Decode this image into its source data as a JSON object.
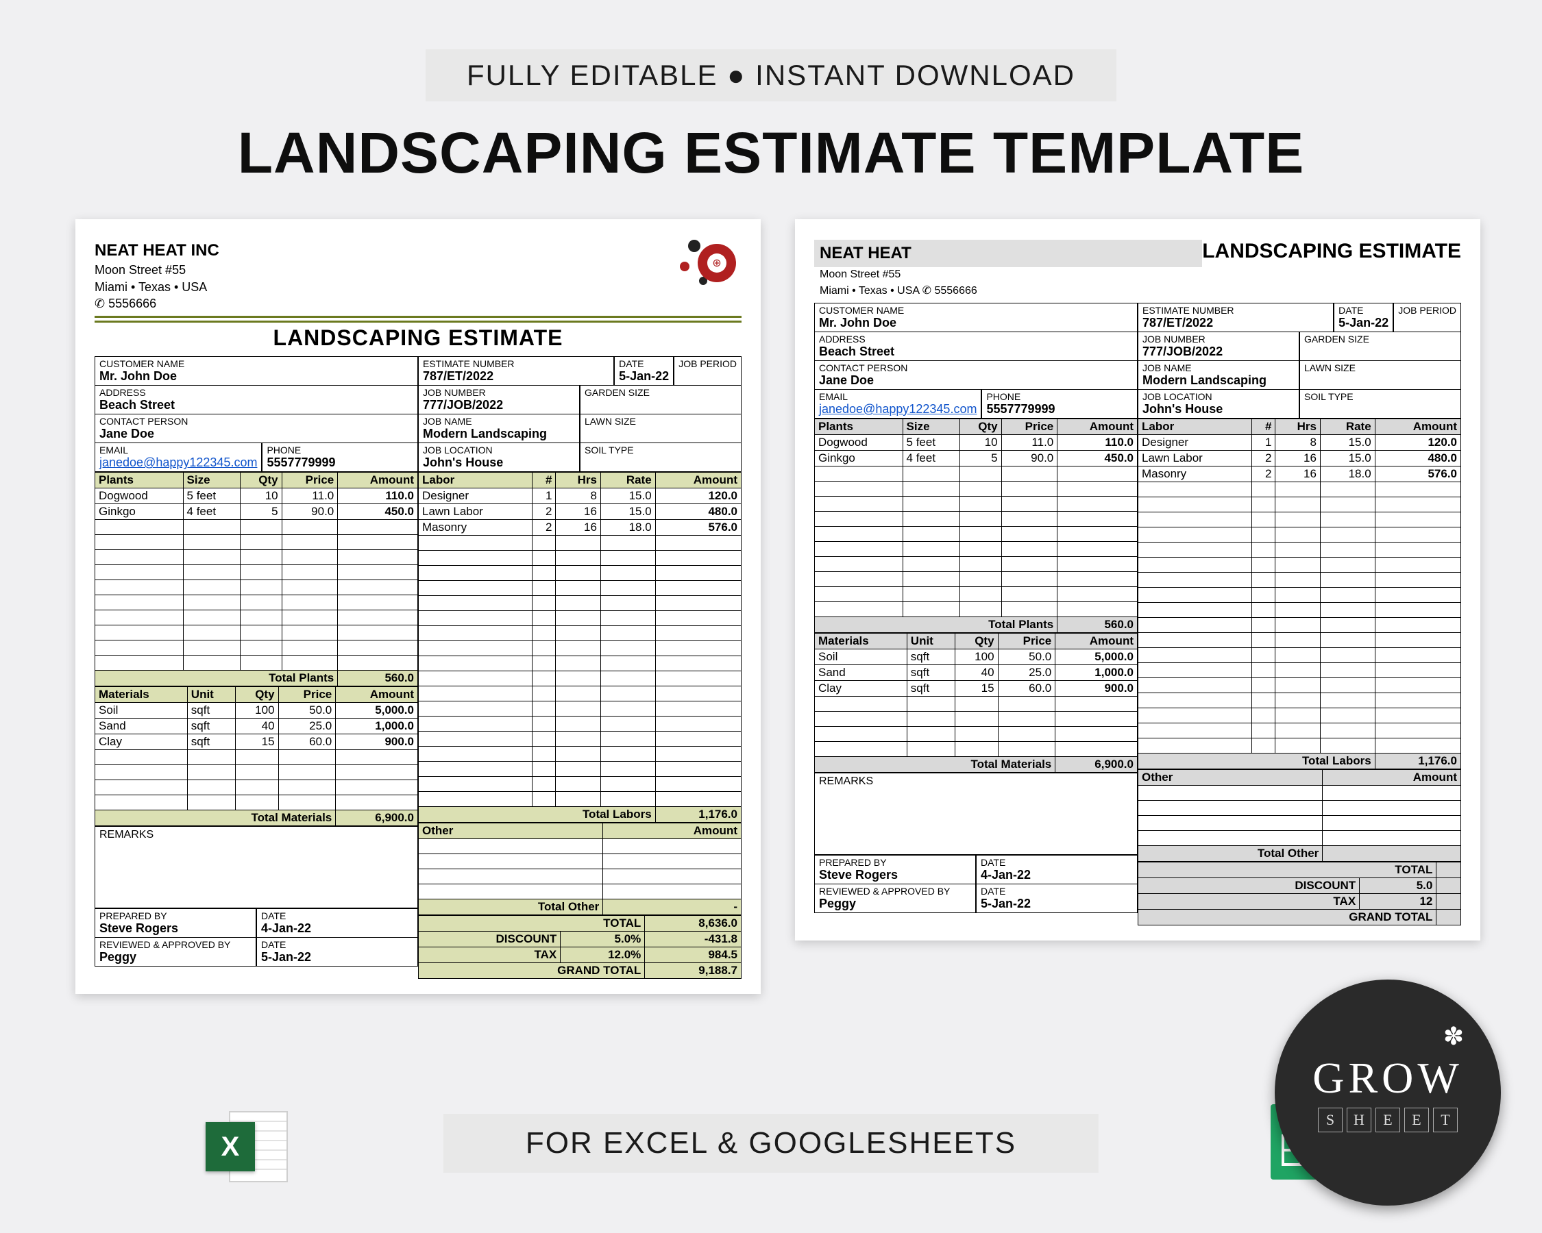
{
  "topBadge": "FULLY EDITABLE ● INSTANT DOWNLOAD",
  "mainTitle": "LANDSCAPING ESTIMATE TEMPLATE",
  "footerBand": "FOR EXCEL & GOOGLESHEETS",
  "growBadge": {
    "word": "GROW",
    "letters": [
      "S",
      "H",
      "E",
      "E",
      "T"
    ]
  },
  "docCommon": {
    "title": "LANDSCAPING ESTIMATE",
    "labels": {
      "customer": "CUSTOMER NAME",
      "address": "ADDRESS",
      "contact": "CONTACT PERSON",
      "email": "EMAIL",
      "phone": "PHONE",
      "estNo": "ESTIMATE NUMBER",
      "date": "DATE",
      "jobPeriod": "JOB PERIOD",
      "jobNo": "JOB NUMBER",
      "garden": "GARDEN SIZE",
      "jobName": "JOB NAME",
      "lawn": "LAWN SIZE",
      "jobLoc": "JOB LOCATION",
      "soil": "SOIL TYPE",
      "remarks": "REMARKS",
      "prepared": "PREPARED BY",
      "reviewed": "REVIEWED & APPROVED BY",
      "dateL": "DATE",
      "total": "TOTAL",
      "discount": "DISCOUNT",
      "tax": "TAX",
      "grand": "GRAND TOTAL",
      "totalPlants": "Total Plants",
      "totalMaterials": "Total Materials",
      "totalLabors": "Total Labors",
      "totalOther": "Total Other"
    },
    "headers": {
      "plants": [
        "Plants",
        "Size",
        "Qty",
        "Price",
        "Amount"
      ],
      "materials": [
        "Materials",
        "Unit",
        "Qty",
        "Price",
        "Amount"
      ],
      "labor": [
        "Labor",
        "#",
        "Hrs",
        "Rate",
        "Amount"
      ],
      "other": [
        "Other",
        "Amount"
      ]
    }
  },
  "left": {
    "brand": {
      "name": "NEAT HEAT INC",
      "street": "Moon Street #55",
      "city": "Miami • Texas • USA",
      "phone": "✆ 5556666"
    },
    "info": {
      "customer": "Mr. John Doe",
      "address": "Beach Street",
      "contact": "Jane Doe",
      "email": "janedoe@happy122345.com",
      "phone": "5557779999",
      "estNo": "787/ET/2022",
      "date": "5-Jan-22",
      "jobNo": "777/JOB/2022",
      "jobName": "Modern Landscaping",
      "jobLoc": "John's House"
    },
    "plants": [
      {
        "name": "Dogwood",
        "size": "5 feet",
        "qty": "10",
        "price": "11.0",
        "amount": "110.0"
      },
      {
        "name": "Ginkgo",
        "size": "4 feet",
        "qty": "5",
        "price": "90.0",
        "amount": "450.0"
      }
    ],
    "plantsTotal": "560.0",
    "materials": [
      {
        "name": "Soil",
        "unit": "sqft",
        "qty": "100",
        "price": "50.0",
        "amount": "5,000.0"
      },
      {
        "name": "Sand",
        "unit": "sqft",
        "qty": "40",
        "price": "25.0",
        "amount": "1,000.0"
      },
      {
        "name": "Clay",
        "unit": "sqft",
        "qty": "15",
        "price": "60.0",
        "amount": "900.0"
      }
    ],
    "materialsTotal": "6,900.0",
    "labor": [
      {
        "name": "Designer",
        "n": "1",
        "hrs": "8",
        "rate": "15.0",
        "amount": "120.0"
      },
      {
        "name": "Lawn Labor",
        "n": "2",
        "hrs": "16",
        "rate": "15.0",
        "amount": "480.0"
      },
      {
        "name": "Masonry",
        "n": "2",
        "hrs": "16",
        "rate": "18.0",
        "amount": "576.0"
      }
    ],
    "laborTotal": "1,176.0",
    "otherTotal": "-",
    "totals": {
      "total": "8,636.0",
      "discPct": "5.0%",
      "disc": "-431.8",
      "taxPct": "12.0%",
      "tax": "984.5",
      "grand": "9,188.7"
    },
    "sign": {
      "prepared": "Steve Rogers",
      "prepDate": "4-Jan-22",
      "reviewed": "Peggy",
      "revDate": "5-Jan-22"
    }
  },
  "right": {
    "brand": {
      "name": "NEAT HEAT",
      "street": "Moon Street #55",
      "city": "Miami • Texas • USA ✆ 5556666"
    },
    "info": {
      "customer": "Mr. John Doe",
      "address": "Beach Street",
      "contact": "Jane Doe",
      "email": "janedoe@happy122345.com",
      "phone": "5557779999",
      "estNo": "787/ET/2022",
      "date": "5-Jan-22",
      "jobNo": "777/JOB/2022",
      "jobName": "Modern Landscaping",
      "jobLoc": "John's House"
    },
    "plants": [
      {
        "name": "Dogwood",
        "size": "5 feet",
        "qty": "10",
        "price": "11.0",
        "amount": "110.0"
      },
      {
        "name": "Ginkgo",
        "size": "4 feet",
        "qty": "5",
        "price": "90.0",
        "amount": "450.0"
      }
    ],
    "plantsTotal": "560.0",
    "materials": [
      {
        "name": "Soil",
        "unit": "sqft",
        "qty": "100",
        "price": "50.0",
        "amount": "5,000.0"
      },
      {
        "name": "Sand",
        "unit": "sqft",
        "qty": "40",
        "price": "25.0",
        "amount": "1,000.0"
      },
      {
        "name": "Clay",
        "unit": "sqft",
        "qty": "15",
        "price": "60.0",
        "amount": "900.0"
      }
    ],
    "materialsTotal": "6,900.0",
    "labor": [
      {
        "name": "Designer",
        "n": "1",
        "hrs": "8",
        "rate": "15.0",
        "amount": "120.0"
      },
      {
        "name": "Lawn Labor",
        "n": "2",
        "hrs": "16",
        "rate": "15.0",
        "amount": "480.0"
      },
      {
        "name": "Masonry",
        "n": "2",
        "hrs": "16",
        "rate": "18.0",
        "amount": "576.0"
      }
    ],
    "laborTotal": "1,176.0",
    "otherTotal": "",
    "totals": {
      "total": "",
      "discPct": "5.0",
      "disc": "",
      "taxPct": "12",
      "tax": "",
      "grand": ""
    },
    "sign": {
      "prepared": "Steve Rogers",
      "prepDate": "4-Jan-22",
      "reviewed": "Peggy",
      "revDate": "5-Jan-22"
    }
  }
}
